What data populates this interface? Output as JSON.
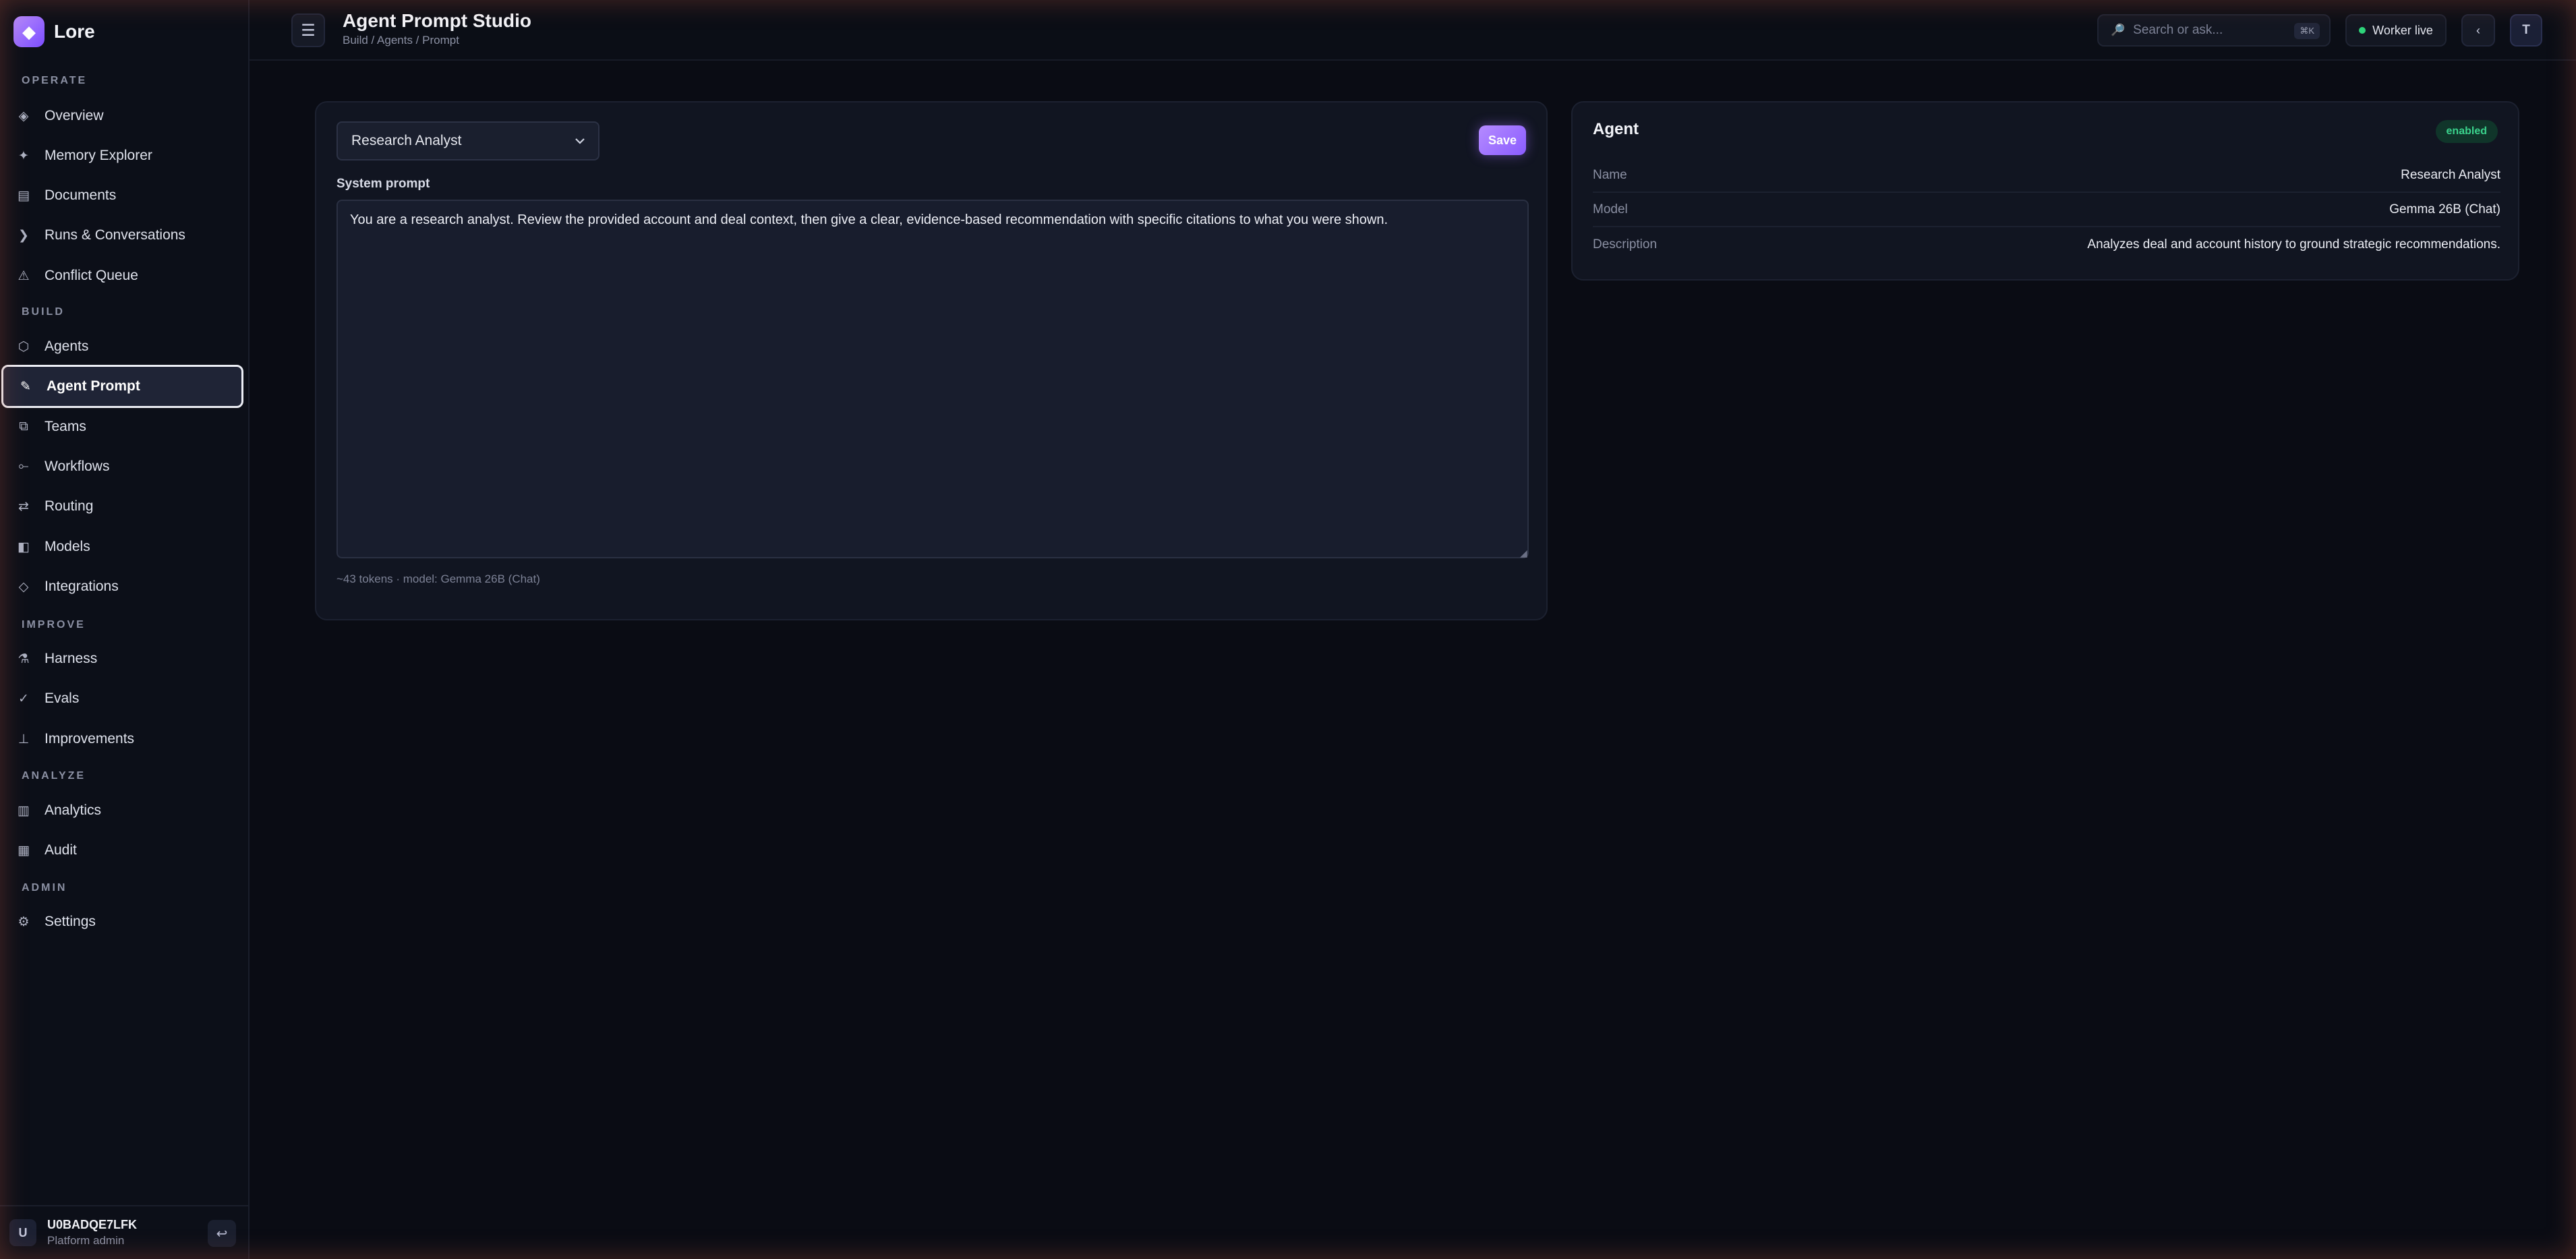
{
  "brand": {
    "name": "Lore",
    "logo_icon": "◆"
  },
  "sidebar": {
    "sections": [
      {
        "title": "OPERATE",
        "items": [
          {
            "label": "Overview",
            "icon": "◈"
          },
          {
            "label": "Memory Explorer",
            "icon": "✦"
          },
          {
            "label": "Documents",
            "icon": "▤"
          },
          {
            "label": "Runs & Conversations",
            "icon": "❯"
          },
          {
            "label": "Conflict Queue",
            "icon": "⚠"
          }
        ]
      },
      {
        "title": "BUILD",
        "items": [
          {
            "label": "Agents",
            "icon": "⬡"
          },
          {
            "label": "Agent Prompt",
            "icon": "✎"
          },
          {
            "label": "Teams",
            "icon": "⧉"
          },
          {
            "label": "Workflows",
            "icon": "⟜"
          },
          {
            "label": "Routing",
            "icon": "⇄"
          },
          {
            "label": "Models",
            "icon": "◧"
          },
          {
            "label": "Integrations",
            "icon": "◇"
          }
        ]
      },
      {
        "title": "IMPROVE",
        "items": [
          {
            "label": "Harness",
            "icon": "⚗"
          },
          {
            "label": "Evals",
            "icon": "✓"
          },
          {
            "label": "Improvements",
            "icon": "⊥"
          }
        ]
      },
      {
        "title": "ANALYZE",
        "items": [
          {
            "label": "Analytics",
            "icon": "▥"
          },
          {
            "label": "Audit",
            "icon": "▦"
          }
        ]
      },
      {
        "title": "ADMIN",
        "items": [
          {
            "label": "Settings",
            "icon": "⚙"
          }
        ]
      }
    ],
    "active_item": "Agent Prompt",
    "footer": {
      "avatar": "U",
      "user_id": "U0BADQE7LFK",
      "role": "Platform admin",
      "logout_icon": "↩"
    }
  },
  "topbar": {
    "menu_icon": "☰",
    "title": "Agent Prompt Studio",
    "breadcrumb": "Build / Agents / Prompt",
    "search_icon": "🔎",
    "search_placeholder": "Search or ask...",
    "search_shortcut": "⌘K",
    "worker_status": "Worker live",
    "collapse_icon": "‹",
    "user_initial": "T"
  },
  "editor": {
    "selected_agent": "Research Analyst",
    "save_label": "Save",
    "field_label": "System prompt",
    "prompt_text": "You are a research analyst. Review the provided account and deal context, then give a clear, evidence-based recommendation with specific citations to what you were shown.",
    "token_info": "~43 tokens · model: Gemma 26B (Chat)"
  },
  "agent_panel": {
    "title": "Agent",
    "badge": "enabled",
    "rows": [
      {
        "key": "Name",
        "value": "Research Analyst"
      },
      {
        "key": "Model",
        "value": "Gemma 26B (Chat)"
      },
      {
        "key": "Description",
        "value": "Analyzes deal and account history to ground strategic recommendations."
      }
    ]
  },
  "colors": {
    "accent": "#9b6bff",
    "status_live": "#2ed47a",
    "badge_green": "#3ad28c"
  }
}
